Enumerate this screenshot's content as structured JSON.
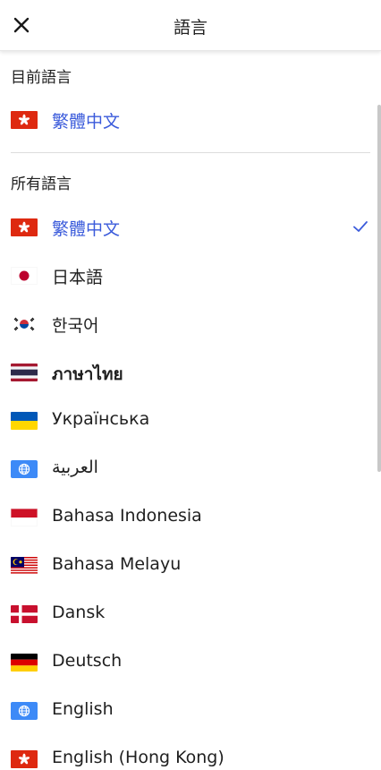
{
  "header": {
    "title": "語言"
  },
  "current_section": {
    "label": "目前語言",
    "item": {
      "label": "繁體中文",
      "flag": "hong-kong-flag"
    }
  },
  "all_section": {
    "label": "所有語言",
    "items": [
      {
        "label": "繁體中文",
        "flag": "hong-kong-flag",
        "selected": true
      },
      {
        "label": "日本語",
        "flag": "japan-flag"
      },
      {
        "label": "한국어",
        "flag": "korea-flag"
      },
      {
        "label": "ภาษาไทย",
        "flag": "thailand-flag"
      },
      {
        "label": "Українська",
        "flag": "ukraine-flag"
      },
      {
        "label": "العربية",
        "flag": "globe-icon"
      },
      {
        "label": "Bahasa Indonesia",
        "flag": "indonesia-flag"
      },
      {
        "label": "Bahasa Melayu",
        "flag": "malaysia-flag"
      },
      {
        "label": "Dansk",
        "flag": "denmark-flag"
      },
      {
        "label": "Deutsch",
        "flag": "germany-flag"
      },
      {
        "label": "English",
        "flag": "globe-icon"
      },
      {
        "label": "English (Hong Kong)",
        "flag": "hong-kong-flag"
      }
    ]
  },
  "colors": {
    "accent": "#3b5bdb",
    "divider": "#dddddd"
  }
}
